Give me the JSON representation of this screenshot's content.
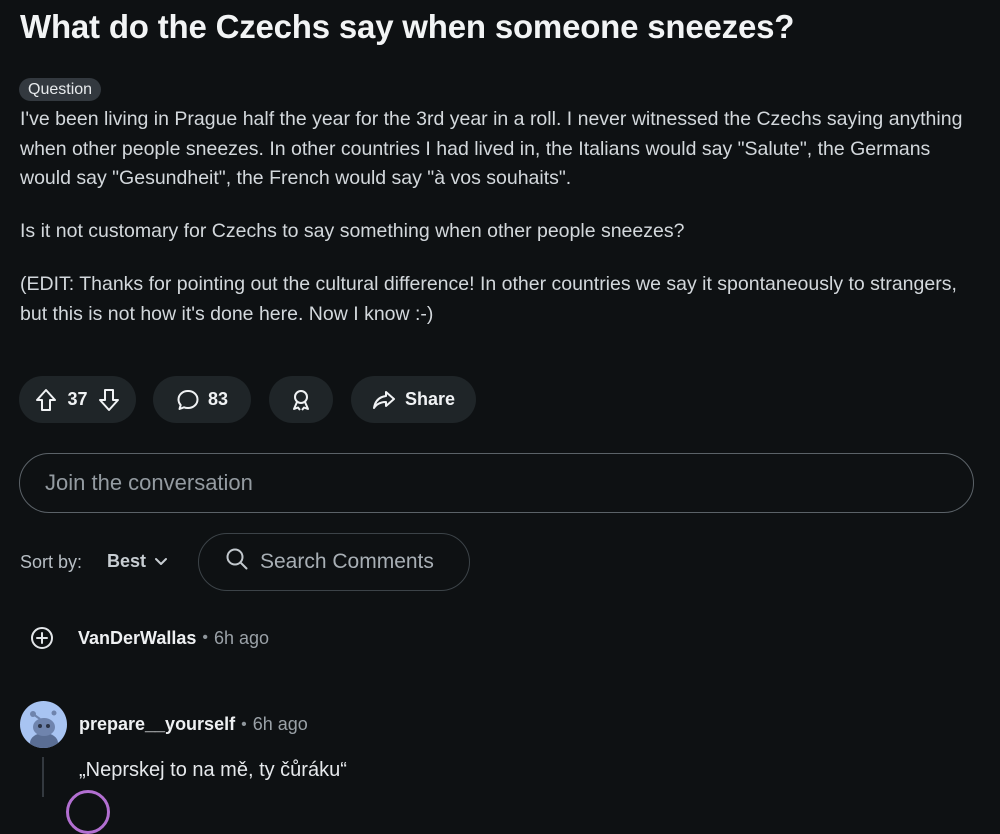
{
  "post": {
    "title": "What do the Czechs say when someone sneezes?",
    "flair": "Question",
    "paragraphs": [
      "I've been living in Prague half the year for the 3rd year in a roll. I never witnessed the Czechs saying anything when other people sneezes. In other countries I had lived in, the Italians would say \"Salute\", the Germans would say \"Gesundheit\", the French would say \"à vos souhaits\".",
      "Is it not customary for Czechs to say something when other people sneezes?",
      "(EDIT: Thanks for pointing out the cultural difference! In other countries we say it spontaneously to strangers, but this is not how it's done here. Now I know :-)"
    ]
  },
  "actions": {
    "vote_count": "37",
    "comment_count": "83",
    "share_label": "Share"
  },
  "composer": {
    "placeholder": "Join the conversation"
  },
  "sort": {
    "label": "Sort by:",
    "value": "Best"
  },
  "search": {
    "placeholder": "Search Comments"
  },
  "comments": [
    {
      "author": "VanDerWallas",
      "time": "6h ago"
    },
    {
      "author": "prepare__yourself",
      "time": "6h ago",
      "text": "„Neprskej to na mě, ty čůráku“"
    }
  ],
  "colors": {
    "background": "#0e1113",
    "pill": "#1f2528",
    "avatar": "#a8c4f2"
  },
  "icons": [
    "upvote-icon",
    "downvote-icon",
    "comment-icon",
    "award-icon",
    "share-icon",
    "chevron-down-icon",
    "search-icon",
    "expand-icon"
  ]
}
